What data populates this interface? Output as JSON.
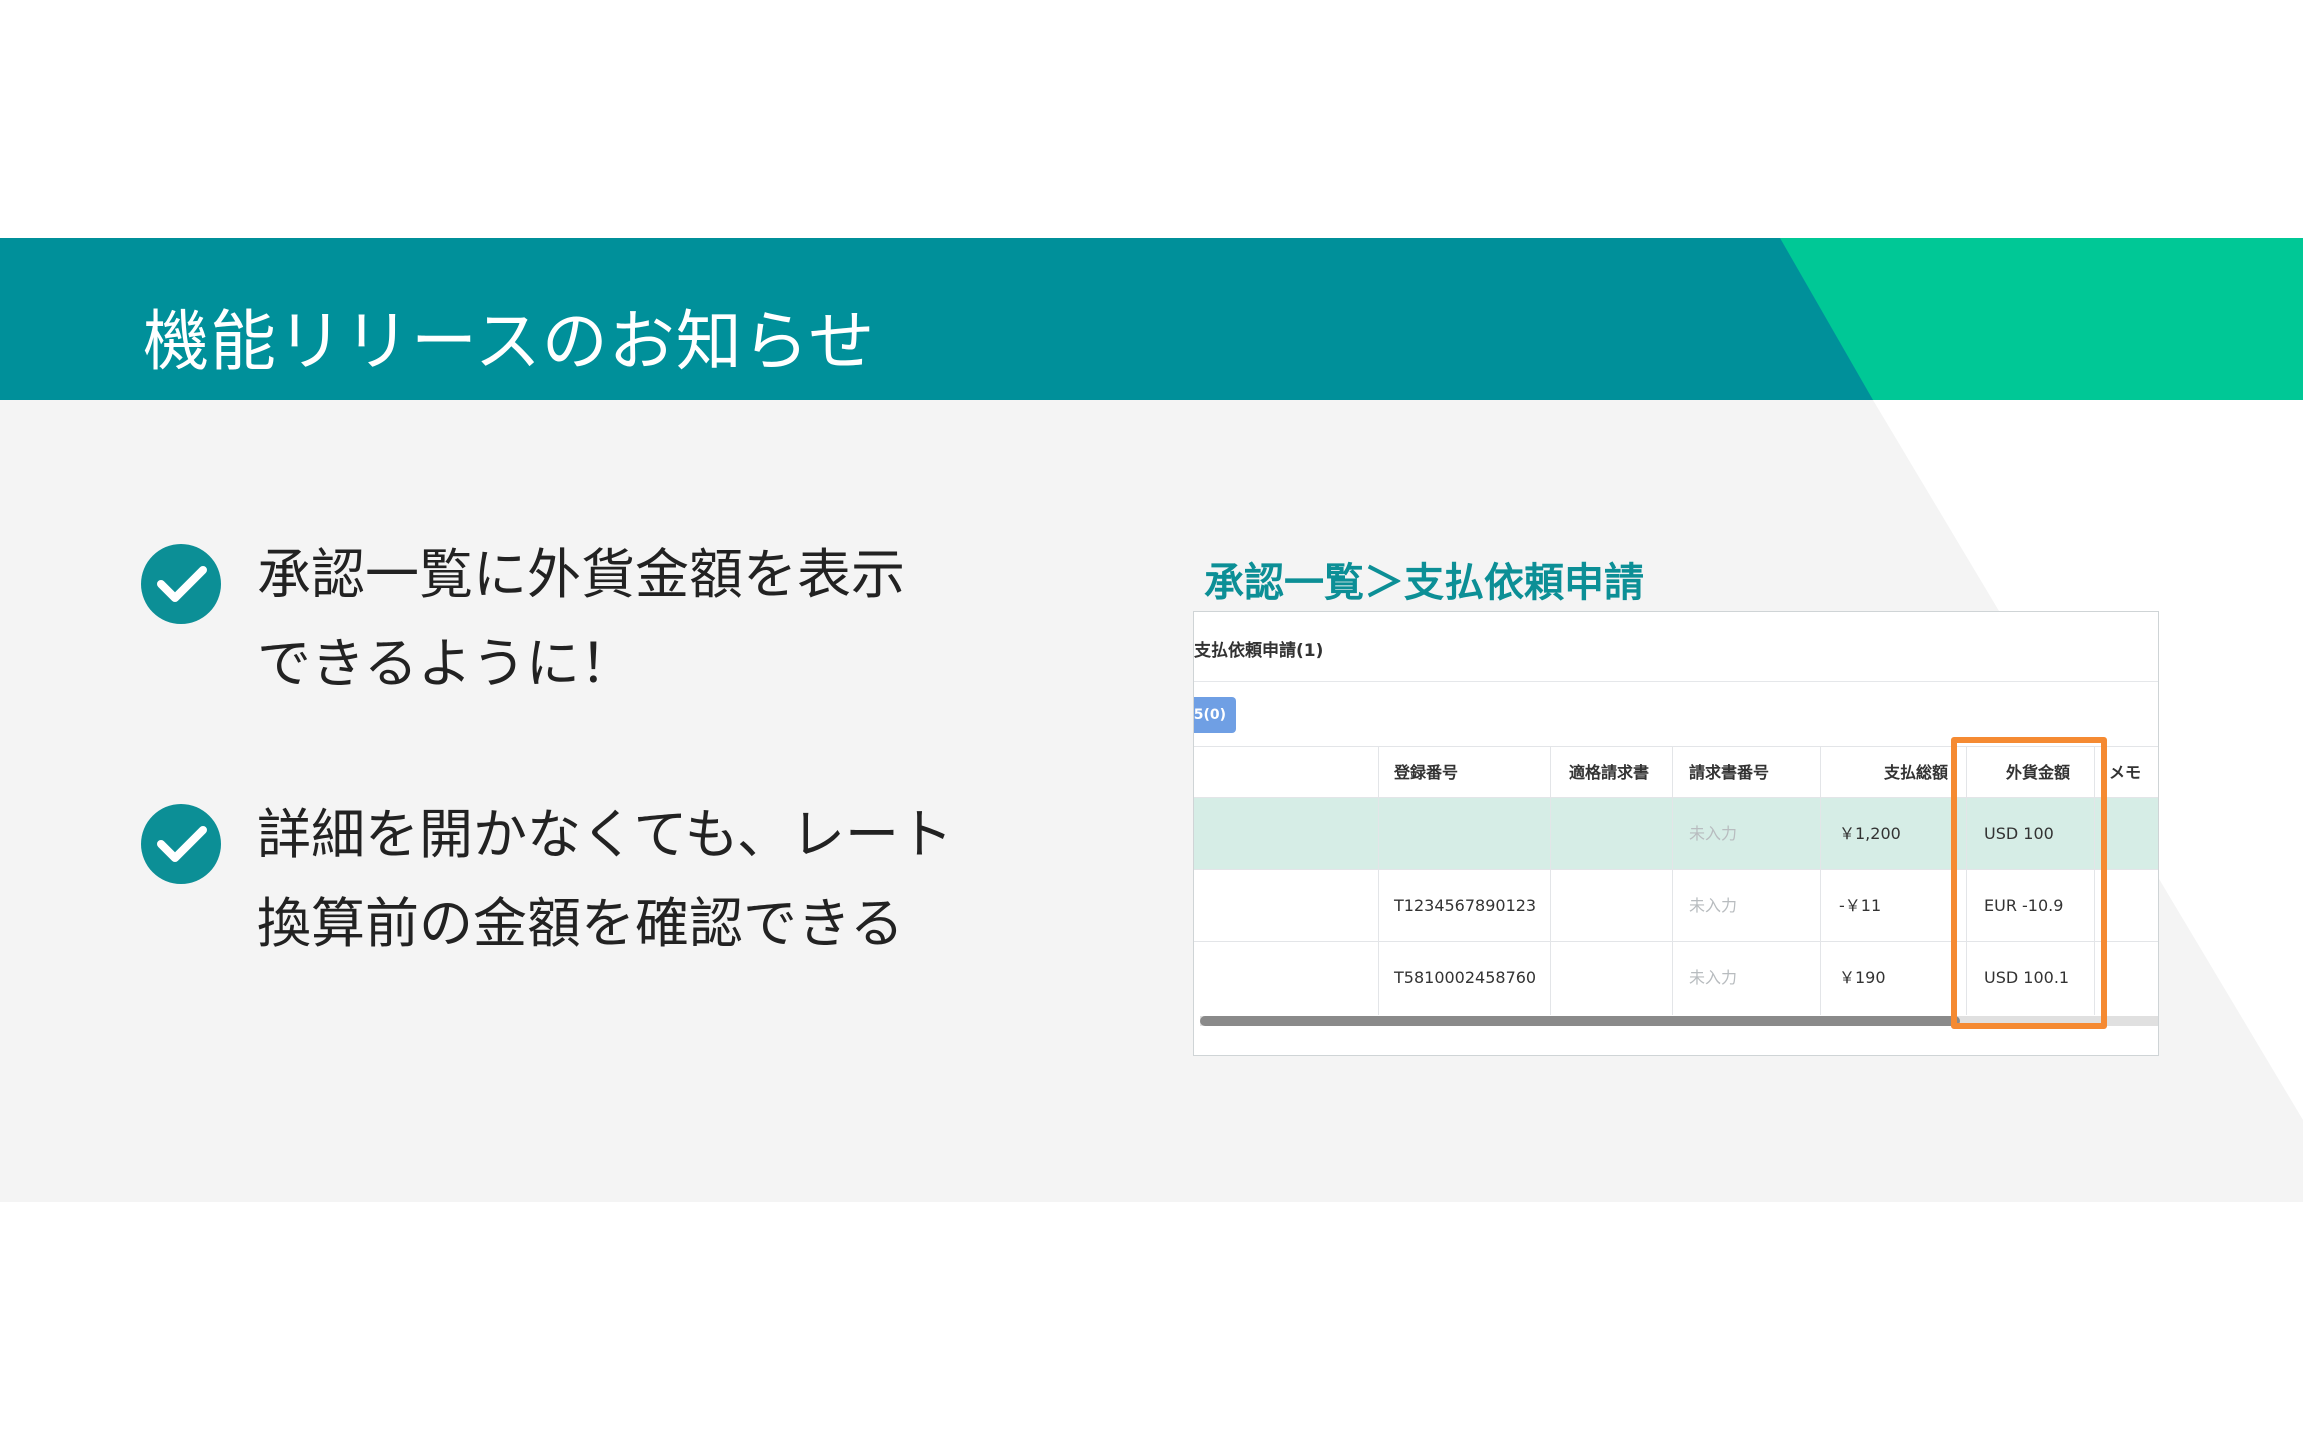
{
  "header": {
    "title": "機能リリースのお知らせ"
  },
  "colors": {
    "header_teal": "#00909a",
    "header_green": "#00c896",
    "check_icon": "#0c8f96",
    "accent_text": "#0c8f96",
    "highlight_row": "#d6ede6",
    "orange_box": "#f58a32"
  },
  "bullets": [
    {
      "icon": "check-circle-icon",
      "line1": "承認一覧に外貨金額を表示",
      "line2": "できるように！"
    },
    {
      "icon": "check-circle-icon",
      "line1": "詳細を開かなくても、レート",
      "line2": "換算前の金額を確認できる"
    }
  ],
  "screenshot": {
    "title": "承認一覧＞支払依頼申請",
    "panel_title": "支払依頼申請(1)",
    "chip_label": "5(0)",
    "columns": [
      "登録番号",
      "適格請求書",
      "請求書番号",
      "支払総額",
      "外貨金額",
      "メモ"
    ],
    "rows": [
      {
        "registration": "",
        "qualified": "",
        "invoice_no": "未入力",
        "total": "￥1,200",
        "foreign": "USD 100",
        "memo": ""
      },
      {
        "registration": "T1234567890123",
        "qualified": "",
        "invoice_no": "未入力",
        "total": "-￥11",
        "foreign": "EUR -10.9",
        "memo": ""
      },
      {
        "registration": "T5810002458760",
        "qualified": "",
        "invoice_no": "未入力",
        "total": "￥190",
        "foreign": "USD 100.1",
        "memo": ""
      }
    ]
  }
}
